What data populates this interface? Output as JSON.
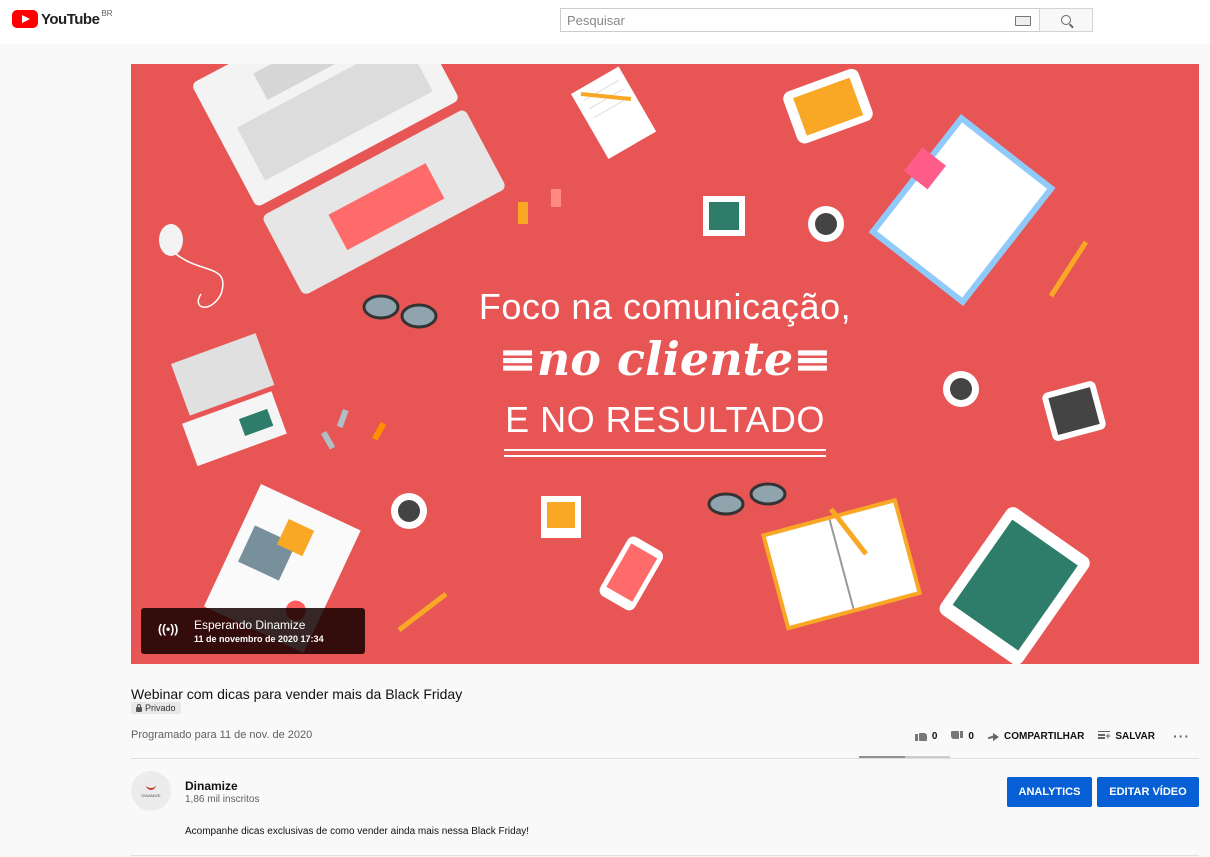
{
  "header": {
    "logo_text": "YouTube",
    "country_code": "BR",
    "search_placeholder": "Pesquisar"
  },
  "player": {
    "hero_line1": "Foco na comunicação,",
    "hero_line2": "≡no cliente≡",
    "hero_line3": "E NO RESULTADO",
    "live_icon": "((•))",
    "live_title": "Esperando Dinamize",
    "live_date": "11 de novembro de 2020 17:34",
    "background_color": "#e85555"
  },
  "video": {
    "title": "Webinar com dicas para vender mais da Black Friday",
    "privacy": "Privado",
    "scheduled": "Programado para 11 de nov. de 2020"
  },
  "actions": {
    "likes": "0",
    "dislikes": "0",
    "share_label": "COMPARTILHAR",
    "save_label": "SALVAR",
    "like_ratio": 0.5
  },
  "channel": {
    "name": "Dinamize",
    "subscribers": "1,86 mil inscritos",
    "avatar_text": "DINAMIZE",
    "description": "Acompanhe dicas exclusivas de como vender ainda mais nessa Black Friday!"
  },
  "buttons": {
    "analytics": "ANALYTICS",
    "edit_video": "EDITAR VÍDEO",
    "accent_color": "#065fd4"
  }
}
